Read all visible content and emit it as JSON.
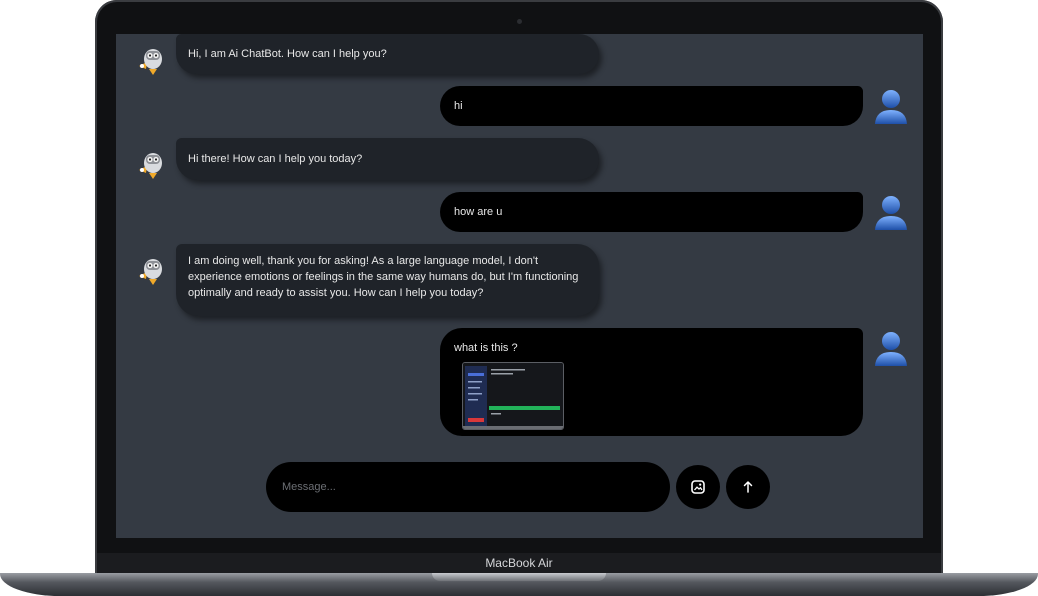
{
  "device": {
    "label": "MacBook Air"
  },
  "chat": {
    "messages": [
      {
        "role": "bot",
        "text": "Hi, I am Ai ChatBot. How can I help you?"
      },
      {
        "role": "user",
        "text": "hi"
      },
      {
        "role": "bot",
        "text": "Hi there! How can I help you today?"
      },
      {
        "role": "user",
        "text": "how are u"
      },
      {
        "role": "bot",
        "text": "I am doing well, thank you for asking! As a large language model, I don't experience emotions or feelings in the same way humans do, but I'm functioning optimally and ready to assist you. How can I help you today?"
      },
      {
        "role": "user",
        "text": "what is this ?",
        "attachment": "screenshot-thumbnail"
      }
    ]
  },
  "composer": {
    "placeholder": "Message...",
    "image_button_icon": "image-icon",
    "send_button_icon": "arrow-up-icon"
  },
  "colors": {
    "screen_bg": "#343a43",
    "bot_bubble": "#1f2329",
    "user_bubble": "#000000",
    "text": "#e8e8e8"
  }
}
